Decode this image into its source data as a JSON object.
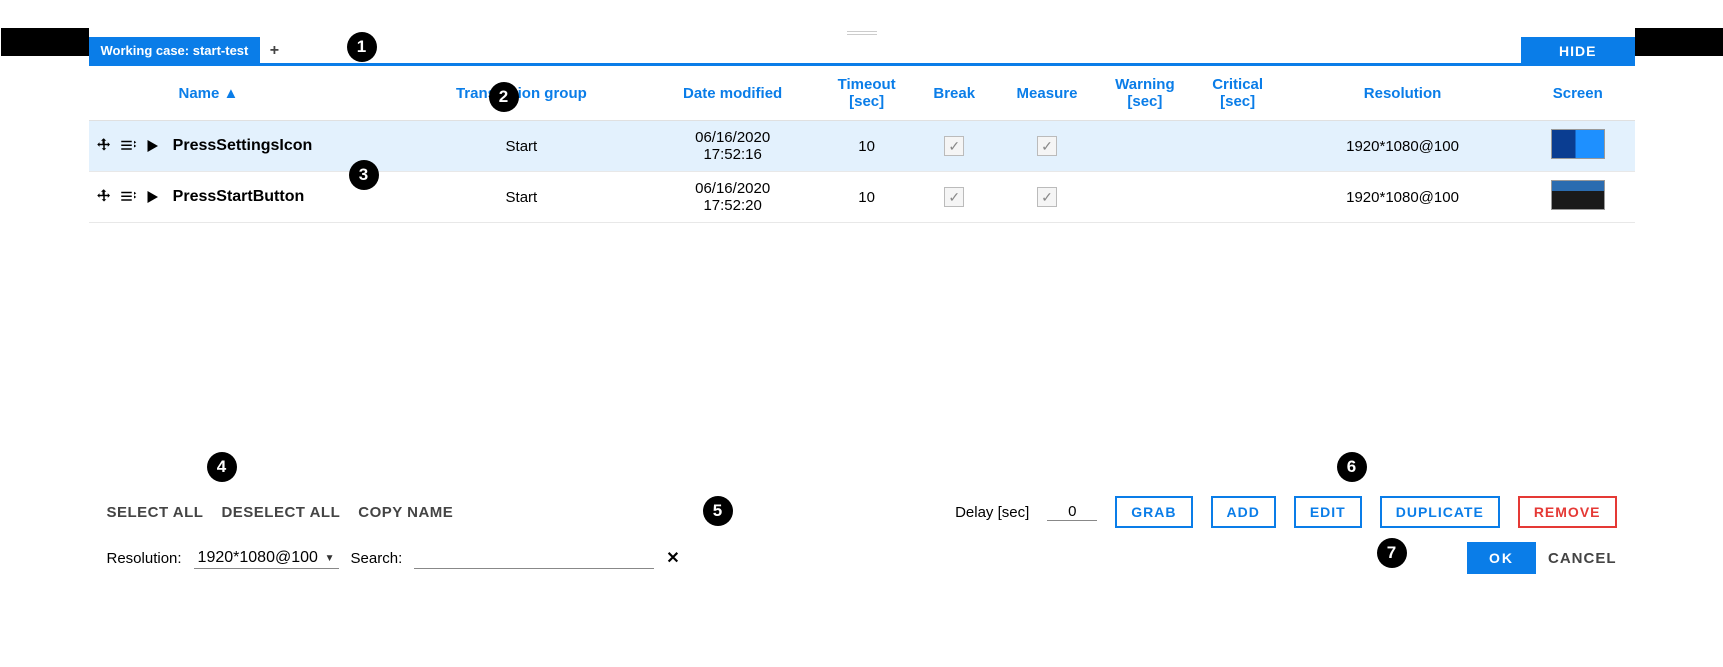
{
  "tabs": {
    "active_label": "Working case: start-test",
    "add_label": "+"
  },
  "hide_label": "HIDE",
  "columns": {
    "name": "Name ▲",
    "tgroup": "Transaction group",
    "date": "Date modified",
    "timeout": "Timeout [sec]",
    "break": "Break",
    "measure": "Measure",
    "warning": "Warning [sec]",
    "critical": "Critical [sec]",
    "resolution": "Resolution",
    "screen": "Screen"
  },
  "rows": [
    {
      "name": "PressSettingsIcon",
      "tgroup": "Start",
      "date": "06/16/2020 17:52:16",
      "timeout": "10",
      "break": true,
      "measure": true,
      "warning": "",
      "critical": "",
      "resolution": "1920*1080@100",
      "selected": true
    },
    {
      "name": "PressStartButton",
      "tgroup": "Start",
      "date": "06/16/2020 17:52:20",
      "timeout": "10",
      "break": true,
      "measure": true,
      "warning": "",
      "critical": "",
      "resolution": "1920*1080@100",
      "selected": false
    }
  ],
  "footer": {
    "select_all": "SELECT ALL",
    "deselect_all": "DESELECT ALL",
    "copy_name": "COPY NAME",
    "delay_label": "Delay [sec]",
    "delay_value": "0",
    "grab": "GRAB",
    "add": "ADD",
    "edit": "EDIT",
    "duplicate": "DUPLICATE",
    "remove": "REMOVE",
    "resolution_label": "Resolution:",
    "resolution_value": "1920*1080@100",
    "search_label": "Search:",
    "search_value": "",
    "ok": "OK",
    "cancel": "CANCEL"
  },
  "callouts": {
    "c1": "1",
    "c2": "2",
    "c3": "3",
    "c4": "4",
    "c5": "5",
    "c6": "6",
    "c7": "7"
  }
}
